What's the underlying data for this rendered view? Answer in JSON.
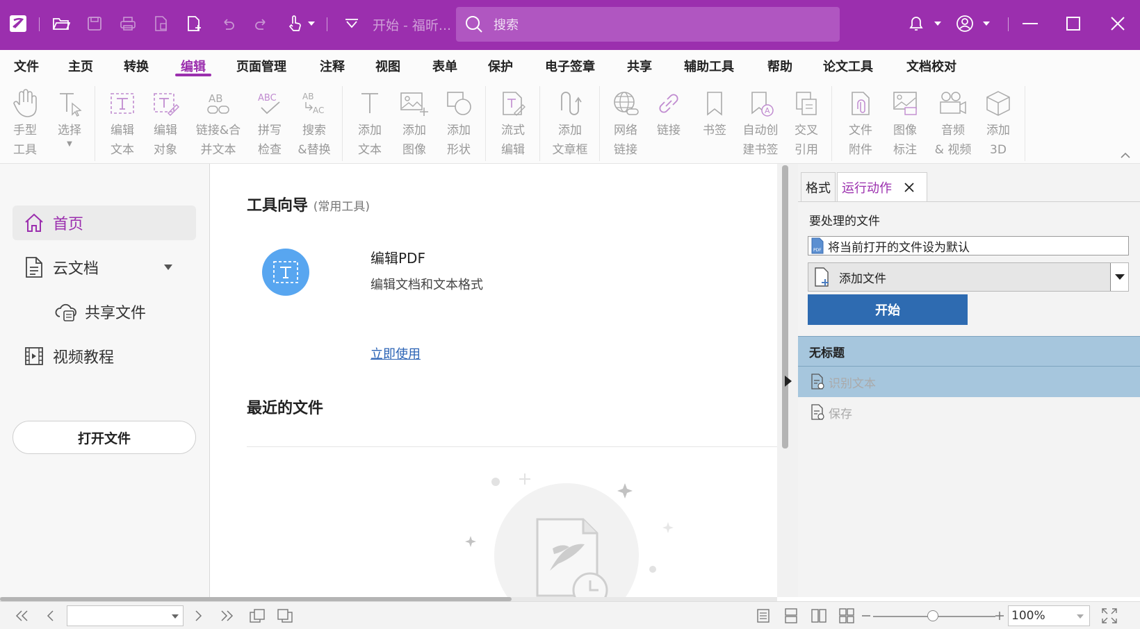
{
  "titlebar": {
    "doc_title": "开始 - 福昕...",
    "search_placeholder": "搜索"
  },
  "menu": [
    "文件",
    "主页",
    "转换",
    "编辑",
    "页面管理",
    "注释",
    "视图",
    "表单",
    "保护",
    "电子签章",
    "共享",
    "辅助工具",
    "帮助",
    "论文工具",
    "文档校对"
  ],
  "menu_active": "编辑",
  "ribbon": {
    "hand_tool": "手型\n工具",
    "select": "选择",
    "edit_text": "编辑\n文本",
    "edit_object": "编辑\n对象",
    "link_merge": "链接&合\n并文本",
    "spell_check": "拼写\n检查",
    "search_replace": "搜索\n&替换",
    "add_text": "添加\n文本",
    "add_image": "添加\n图像",
    "add_shape": "添加\n形状",
    "flow_edit": "流式\n编辑",
    "add_article": "添加\n文章框",
    "web_link": "网络\n链接",
    "link": "链接",
    "bookmark": "书签",
    "auto_bookmark": "自动创\n建书签",
    "cross_ref": "交叉\n引用",
    "file_attach": "文件\n附件",
    "image_mark": "图像\n标注",
    "audio_video": "音频\n& 视频",
    "add_3d": "添加\n3D"
  },
  "sidebar": {
    "home": "首页",
    "cloud_docs": "云文档",
    "shared_files": "共享文件",
    "video_tutorials": "视频教程",
    "open_file": "打开文件"
  },
  "main": {
    "tool_guide": "工具向导",
    "tool_guide_sub": "(常用工具)",
    "tool_title": "编辑PDF",
    "tool_desc": "编辑文档和文本格式",
    "tool_link": "立即使用",
    "recent_files": "最近的文件"
  },
  "panel": {
    "tab_format": "格式",
    "tab_run_action": "运行动作",
    "files_label": "要处理的文件",
    "default_file": "将当前打开的文件设为默认",
    "add_file": "添加文件",
    "start": "开始",
    "group_title": "无标题",
    "action_ocr": "识别文本",
    "action_save": "保存"
  },
  "status": {
    "zoom": "100%"
  },
  "colors": {
    "brand": "#9b2fae",
    "start_button": "#2e6bb1",
    "action_header": "#a6c6dd",
    "tool_circle": "#58a6f0"
  }
}
